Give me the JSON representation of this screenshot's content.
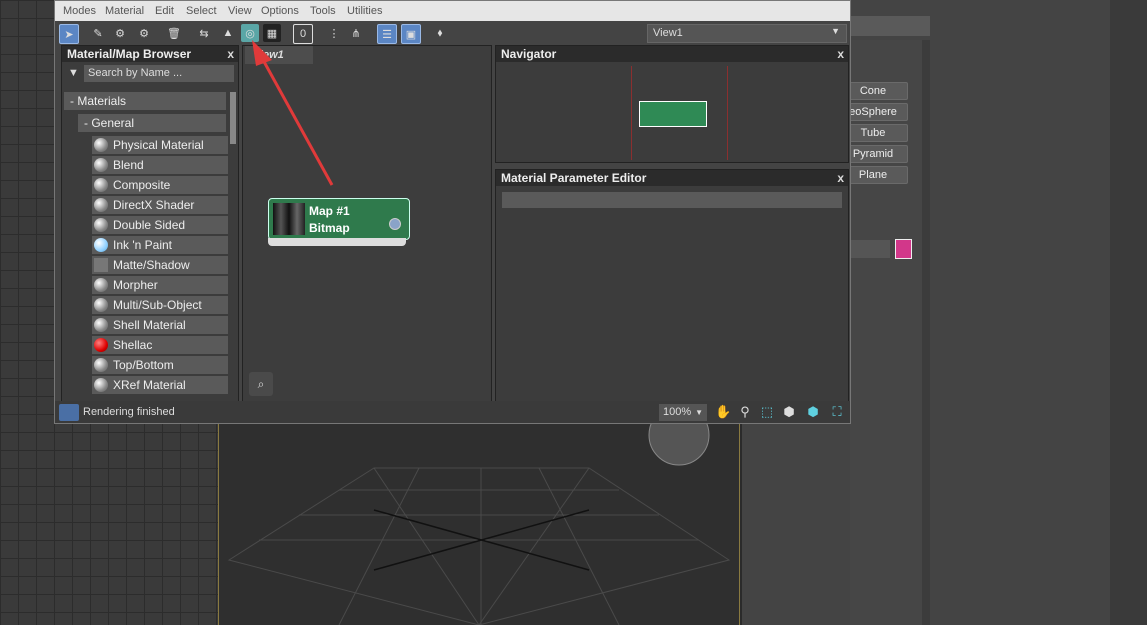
{
  "menu": [
    "Modes",
    "Material",
    "Edit",
    "Select",
    "View",
    "Options",
    "Tools",
    "Utilities"
  ],
  "toolbar": {
    "view_dropdown": "View1"
  },
  "browser": {
    "title": "Material/Map Browser",
    "close": "x",
    "search_placeholder": "Search by Name ...",
    "group_materials": "- Materials",
    "group_general": "- General",
    "materials": [
      "Physical Material",
      "Blend",
      "Composite",
      "DirectX Shader",
      "Double Sided",
      "Ink 'n Paint",
      "Matte/Shadow",
      "Morpher",
      "Multi/Sub-Object",
      "Shell Material",
      "Shellac",
      "Top/Bottom",
      "XRef Material"
    ]
  },
  "view": {
    "tab": "View1",
    "node_title": "Map #1",
    "node_type": "Bitmap"
  },
  "navigator": {
    "title": "Navigator",
    "close": "x"
  },
  "param_editor": {
    "title": "Material Parameter Editor",
    "close": "x"
  },
  "status": {
    "text": "Rendering finished",
    "zoom": "100%"
  },
  "command_panel": {
    "buttons": [
      "Cone",
      "eoSphere",
      "Tube",
      "Pyramid",
      "Plane"
    ],
    "accent_color": "#d2378a"
  },
  "colors": {
    "node_green": "#2f7a4c",
    "arrow": "#e03a3a",
    "selected": "#5b86c4"
  }
}
